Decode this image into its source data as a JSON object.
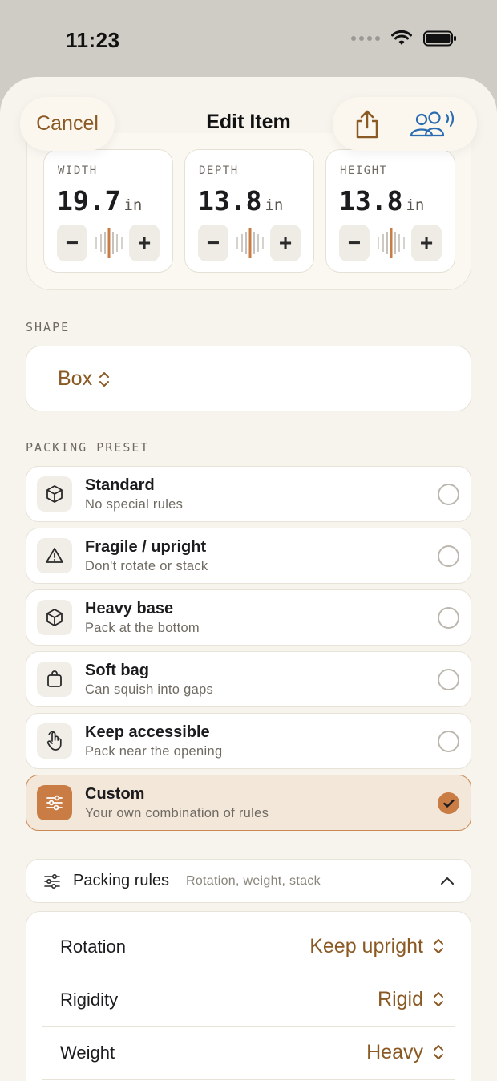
{
  "status_bar": {
    "time": "11:23"
  },
  "nav": {
    "cancel_label": "Cancel",
    "title": "Edit Item"
  },
  "dimensions": [
    {
      "label": "WIDTH",
      "value": "19.7",
      "unit": "in"
    },
    {
      "label": "DEPTH",
      "value": "13.8",
      "unit": "in"
    },
    {
      "label": "HEIGHT",
      "value": "13.8",
      "unit": "in"
    }
  ],
  "shape": {
    "section_label": "SHAPE",
    "value": "Box"
  },
  "packing_preset": {
    "section_label": "PACKING PRESET",
    "items": [
      {
        "title": "Standard",
        "subtitle": "No special rules",
        "icon": "cube-icon",
        "selected": false
      },
      {
        "title": "Fragile / upright",
        "subtitle": "Don't rotate or stack",
        "icon": "warning-triangle-icon",
        "selected": false
      },
      {
        "title": "Heavy base",
        "subtitle": "Pack at the bottom",
        "icon": "cube-icon",
        "selected": false
      },
      {
        "title": "Soft bag",
        "subtitle": "Can squish into gaps",
        "icon": "bag-icon",
        "selected": false
      },
      {
        "title": "Keep accessible",
        "subtitle": "Pack near the opening",
        "icon": "hand-pointer-icon",
        "selected": false
      },
      {
        "title": "Custom",
        "subtitle": "Your own combination of rules",
        "icon": "sliders-icon",
        "selected": true
      }
    ]
  },
  "packing_rules": {
    "title": "Packing rules",
    "subtitle": "Rotation, weight, stack",
    "rows": [
      {
        "label": "Rotation",
        "value": "Keep upright"
      },
      {
        "label": "Rigidity",
        "value": "Rigid"
      },
      {
        "label": "Weight",
        "value": "Heavy"
      }
    ]
  },
  "colors": {
    "accent": "#8b5a24",
    "accent_fill": "#c97c44",
    "sheet_background": "#f7f4ee",
    "selected_background": "#f3e7da",
    "share_people_icon": "#2b6cb0"
  }
}
